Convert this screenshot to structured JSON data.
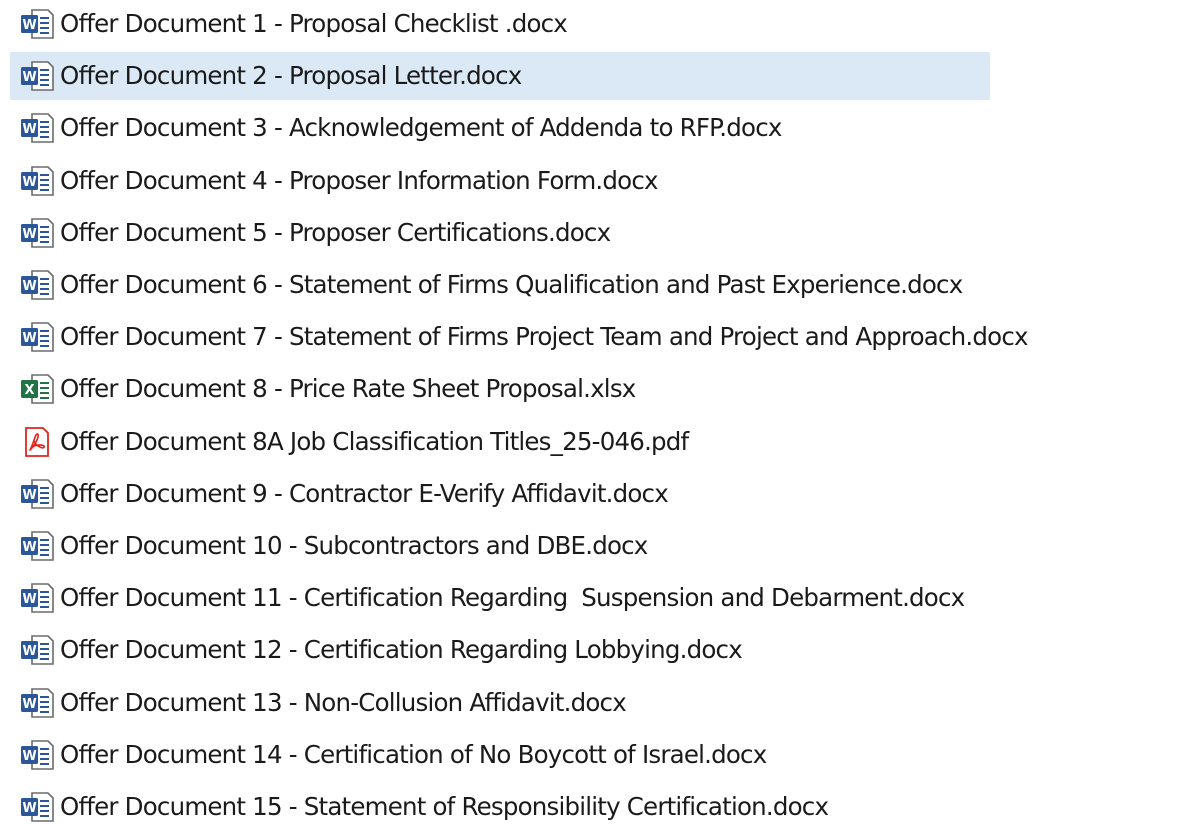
{
  "files": [
    {
      "name": "Offer Document 1 - Proposal Checklist .docx",
      "type": "word-doc-icon",
      "selected": false
    },
    {
      "name": "Offer Document 2 - Proposal Letter.docx",
      "type": "word-doc-icon",
      "selected": true
    },
    {
      "name": "Offer Document 3 - Acknowledgement of Addenda to RFP.docx",
      "type": "word-doc-icon",
      "selected": false
    },
    {
      "name": "Offer Document 4 - Proposer Information Form.docx",
      "type": "word-doc-icon",
      "selected": false
    },
    {
      "name": "Offer Document 5 - Proposer Certifications.docx",
      "type": "word-doc-icon",
      "selected": false
    },
    {
      "name": "Offer Document 6 - Statement of Firms Qualification and Past Experience.docx",
      "type": "word-doc-icon",
      "selected": false
    },
    {
      "name": "Offer Document 7 - Statement of Firms Project Team and Project and Approach.docx",
      "type": "word-doc-icon",
      "selected": false
    },
    {
      "name": "Offer Document 8 - Price Rate Sheet Proposal.xlsx",
      "type": "excel-sheet-icon",
      "selected": false
    },
    {
      "name": "Offer Document 8A Job Classification Titles_25-046.pdf",
      "type": "pdf-icon",
      "selected": false
    },
    {
      "name": "Offer Document 9 - Contractor E-Verify Affidavit.docx",
      "type": "word-doc-icon",
      "selected": false
    },
    {
      "name": "Offer Document 10 - Subcontractors and DBE.docx",
      "type": "word-doc-icon",
      "selected": false
    },
    {
      "name": "Offer Document 11 - Certification Regarding  Suspension and Debarment.docx",
      "type": "word-doc-icon",
      "selected": false
    },
    {
      "name": "Offer Document 12 - Certification Regarding Lobbying.docx",
      "type": "word-doc-icon",
      "selected": false
    },
    {
      "name": "Offer Document 13 - Non-Collusion Affidavit.docx",
      "type": "word-doc-icon",
      "selected": false
    },
    {
      "name": "Offer Document 14 - Certification of No Boycott of Israel.docx",
      "type": "word-doc-icon",
      "selected": false
    },
    {
      "name": "Offer Document 15 - Statement of Responsibility Certification.docx",
      "type": "word-doc-icon",
      "selected": false
    }
  ],
  "colors": {
    "selection": "#dbe9f6",
    "word": "#2b579a",
    "excel": "#217346",
    "pdf": "#e0261b",
    "text": "#1a1a1a"
  }
}
